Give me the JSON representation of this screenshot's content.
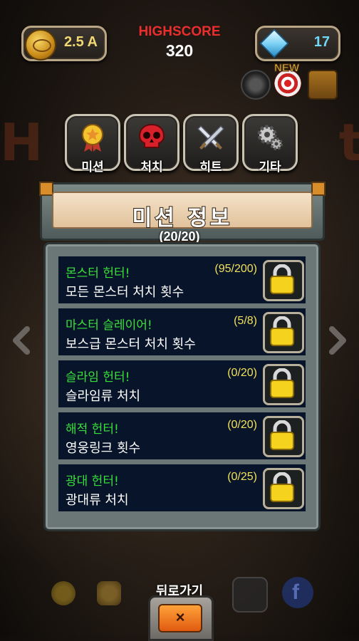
{
  "currency": {
    "coins": "2.5 A",
    "gems": "17"
  },
  "highscore": {
    "label": "HIGHSCORE",
    "value": "320"
  },
  "top_icons": {
    "new_badge": "NEW",
    "icons": [
      "disc-icon",
      "target-icon",
      "chest-icon"
    ]
  },
  "categories": [
    {
      "label": "미션",
      "icon": "medal-icon"
    },
    {
      "label": "처치",
      "icon": "skull-icon"
    },
    {
      "label": "히트",
      "icon": "crossed-swords-icon"
    },
    {
      "label": "기타",
      "icon": "gears-icon"
    }
  ],
  "panel": {
    "title": "미션 정보",
    "counter": "(20/20)"
  },
  "missions": [
    {
      "name": "몬스터 헌터!",
      "progress": "(95/200)",
      "desc": "모든 몬스터 처치 횟수",
      "locked": true
    },
    {
      "name": "마스터 슬레이어!",
      "progress": "(5/8)",
      "desc": "보스급 몬스터 처치 횟수",
      "locked": true
    },
    {
      "name": "슬라임 헌터!",
      "progress": "(0/20)",
      "desc": "슬라임류 처치",
      "locked": true
    },
    {
      "name": "해적 헌터!",
      "progress": "(0/20)",
      "desc": "영웅링크 횟수",
      "locked": true
    },
    {
      "name": "광대 헌터!",
      "progress": "(0/25)",
      "desc": "광대류 처치",
      "locked": true
    }
  ],
  "footer": {
    "back_label": "뒤로가기",
    "back_symbol": "×",
    "fb_letter": "f"
  },
  "colors": {
    "mission_name": "#38e03a",
    "progress": "#f1e15a",
    "highscore": "#ea2d2d",
    "gems": "#6fd8f4"
  }
}
